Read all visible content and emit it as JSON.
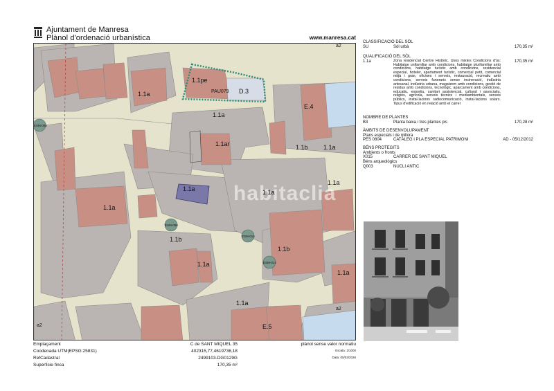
{
  "header": {
    "org_line1": "Ajuntament de Manresa",
    "org_line2": "Plànol d'ordenació urbanística",
    "website": "www.manresa.cat"
  },
  "map": {
    "watermark": "habitaclia",
    "zone_labels": [
      {
        "text": "1.1pe",
        "key": "z1"
      },
      {
        "text": "D.3",
        "key": "z2"
      },
      {
        "text": "PAU079",
        "key": "z3"
      },
      {
        "text": "1.1a",
        "key": "z4"
      },
      {
        "text": "1.1a",
        "key": "z5"
      },
      {
        "text": "1.1ar",
        "key": "z6"
      },
      {
        "text": "E.4",
        "key": "z7"
      },
      {
        "text": "1.1b",
        "key": "z8"
      },
      {
        "text": "1.1a",
        "key": "z9"
      },
      {
        "text": "1.1a",
        "key": "z10"
      },
      {
        "text": "1.1a",
        "key": "z11"
      },
      {
        "text": "1.1a",
        "key": "z12"
      },
      {
        "text": "1.1b",
        "key": "z13"
      },
      {
        "text": "1.1a",
        "key": "z14"
      },
      {
        "text": "1.1b",
        "key": "z15"
      },
      {
        "text": "1.1a",
        "key": "z16"
      },
      {
        "text": "1.1a",
        "key": "z17"
      },
      {
        "text": "E.5",
        "key": "z18"
      },
      {
        "text": "a2",
        "key": "z19"
      },
      {
        "text": "a2",
        "key": "z20"
      },
      {
        "text": "a2",
        "key": "z21"
      },
      {
        "text": "1.1a",
        "key": "z22"
      }
    ],
    "tree_labels": [
      "ESM-006",
      "ESM-098",
      "ESM-014",
      "ESM-014"
    ]
  },
  "footer": {
    "rows": [
      {
        "key": "Emplaçament",
        "value": "C de SANT MIQUEL 35",
        "right": "plànol sense valor normatiu"
      },
      {
        "key": "Coodenada UTM(EPSG:25831)",
        "value": "402315,77,4619736,18",
        "right": "Escala: 1/1000"
      },
      {
        "key": "RefCadastral",
        "value": "2499103-DG0129G",
        "right": "Data: 05/03/2026"
      },
      {
        "key": "Superficie finca",
        "value": "170,35 m²",
        "right": ""
      }
    ]
  },
  "info": {
    "classificacio_title": "CLASSIFICACIÓ DEL SÒL",
    "classificacio_code": "SU",
    "classificacio_name": "Sòl urbà",
    "classificacio_area": "170,35 m²",
    "qualificacio_title": "QUALIFICACIÓ DEL SÒL",
    "qualificacio_code": "1.1a",
    "qualificacio_area": "170,35 m²",
    "qualificacio_desc": "Zona residencial Centre Històric. Usos mixtes Condicions d'ús: Habitatge unifamiliar amb condicions, habitatge plurifamiliar amb condicions, habitatge turístic amb condicions, residencial especial, hoteler, apartament turístic, comercial petit, comercial mitjà i gran, oficines i serveis, restauració, recreatiu amb condicions, serveis funeraris sense incineració, indústria artesanal, indústria urbana, magatzem amb condicions, gestió de residus amb condicions, tecnològic, aparcament amb condicions, educatiu, esportiu, sanitari assistencial, cultural i associatiu, religiós, agrícola, serveis tècnics i mediambientals, serveis públics, instal·lacions radiocomunicació, instal·lacions solars. Tipus d'edificació en relació amb el carrer",
    "plantes_title": "NOMBRE DE PLANTES",
    "plantes_code": "B3",
    "plantes_name": "Planta baixa i tres plantes pis",
    "plantes_area": "170,28 m²",
    "ambits_title": "ÀMBITS DE DESENVOLUPAMENT",
    "ambits_sub": "Plans especials i de millora",
    "ambits_code": "PES 0804",
    "ambits_name": "CATÀLEG I PLA ESPECIAL PATRIMONI",
    "ambits_date": "AD - 05/12/2012",
    "bens_title": "BÉNS PROTEGITS",
    "bens_sub1": "Ambients o fronts",
    "bens_code1": "X015",
    "bens_name1": "CARRER DE SANT MIQUEL",
    "bens_sub2": "Béns arqueològics",
    "bens_code2": "Q003",
    "bens_name2": "NUCLI ANTIC"
  },
  "colors": {
    "parcel_residential": "#c89085",
    "parcel_block": "#bab5b3",
    "street": "#e6e3cd",
    "equipment": "#c6dbee",
    "target": "#7a78a8",
    "tree": "#7b9a8d"
  }
}
